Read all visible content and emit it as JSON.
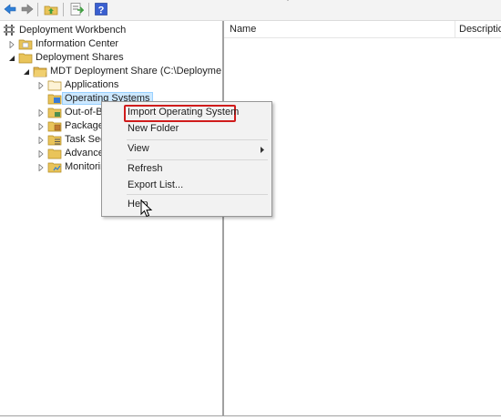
{
  "toolbar": {
    "buttons": [
      {
        "icon": "back-arrow-icon"
      },
      {
        "icon": "forward-arrow-icon"
      },
      {
        "icon": "up-folder-icon"
      },
      {
        "icon": "export-list-icon"
      },
      {
        "icon": "help-icon"
      }
    ]
  },
  "tree": {
    "root": "Deployment Workbench",
    "items": [
      {
        "label": "Information Center",
        "icon": "info-center-icon",
        "expander": "collapsed"
      },
      {
        "label": "Deployment Shares",
        "icon": "folder-icon",
        "expander": "expanded"
      },
      {
        "label": "MDT Deployment Share (C:\\DeploymentS",
        "icon": "deployment-share-icon",
        "expander": "expanded"
      },
      {
        "label": "Applications",
        "icon": "folder-icon",
        "expander": "collapsed"
      },
      {
        "label": "Operating Systems",
        "icon": "os-folder-icon",
        "expander": "none",
        "selected": true
      },
      {
        "label": "Out-of-B",
        "icon": "drivers-folder-icon",
        "expander": "collapsed"
      },
      {
        "label": "Packages",
        "icon": "packages-folder-icon",
        "expander": "collapsed"
      },
      {
        "label": "Task Sequ",
        "icon": "task-sequence-folder-icon",
        "expander": "collapsed"
      },
      {
        "label": "Advanced",
        "icon": "folder-icon",
        "expander": "collapsed"
      },
      {
        "label": "Monitorin",
        "icon": "monitoring-folder-icon",
        "expander": "collapsed"
      }
    ]
  },
  "list": {
    "columns": [
      "Name",
      "Descriptio"
    ]
  },
  "context_menu": {
    "items": [
      {
        "label": "Import Operating System",
        "highlighted": true
      },
      {
        "label": "New Folder"
      },
      {
        "separator": true
      },
      {
        "label": "View",
        "submenu": true
      },
      {
        "separator": true
      },
      {
        "label": "Refresh"
      },
      {
        "label": "Export List..."
      },
      {
        "separator": true
      },
      {
        "label": "Help"
      }
    ],
    "highlight_color": "#d01c1c"
  },
  "colors": {
    "selection": "#cce8ff",
    "pane_border": "#a0a0a0",
    "menu_background": "#f2f2f2"
  }
}
